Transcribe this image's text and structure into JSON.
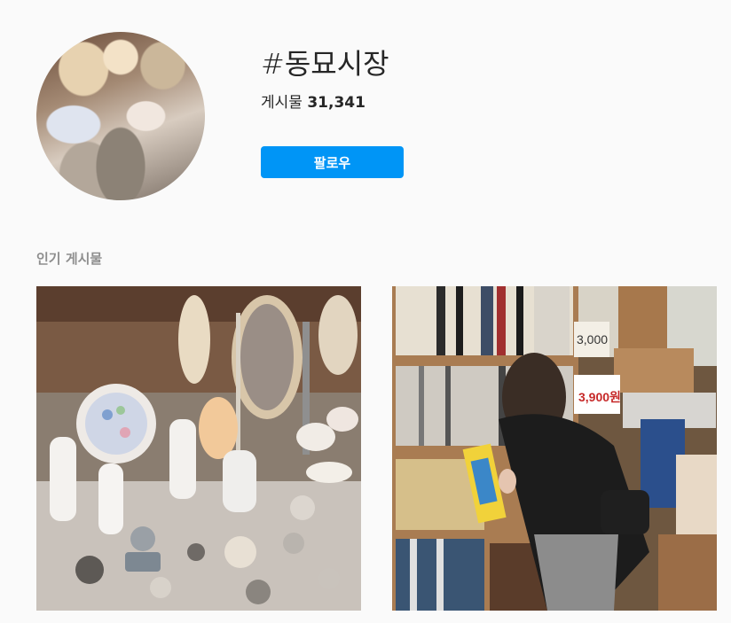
{
  "header": {
    "hashtag": "#동묘시장",
    "posts_label": "게시물",
    "posts_count": "31,341",
    "follow_label": "팔로우"
  },
  "colors": {
    "accent": "#0095f6",
    "section_title": "#8e8e8e",
    "background": "#fafafa"
  },
  "top_posts": {
    "title": "인기 게시물",
    "items": [
      {
        "image": "antique-porcelain-figurines"
      },
      {
        "image": "record-shop-browsing"
      }
    ],
    "price_sign": "3,900원",
    "price_tag": "3,000"
  }
}
